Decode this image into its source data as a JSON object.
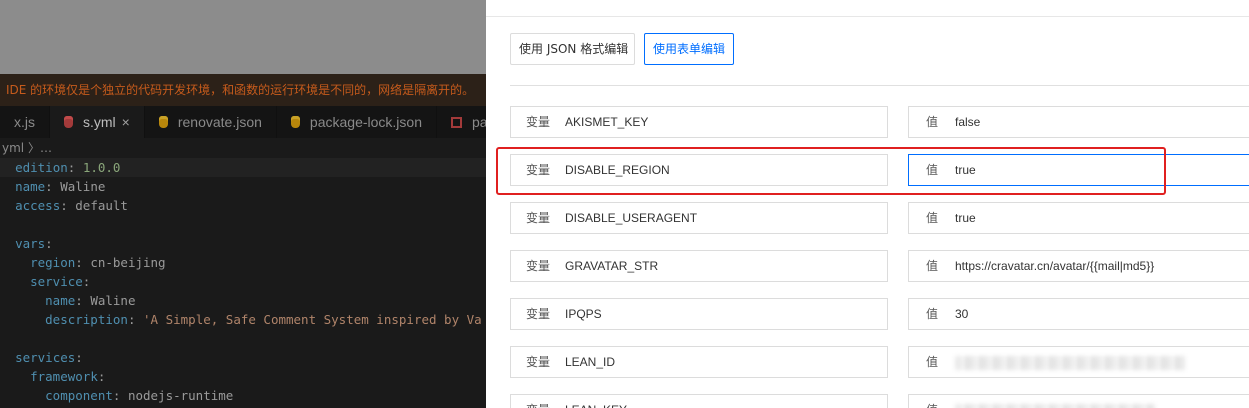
{
  "ide": {
    "notice": "IDE 的环境仅是个独立的代码开发环境，和函数的运行环境是不同的，网络是隔离开的。",
    "tabs": [
      {
        "label": "x.js",
        "icon": "none",
        "active": false
      },
      {
        "label": "s.yml",
        "icon": "database-icon",
        "active": true,
        "close": "×"
      },
      {
        "label": "renovate.json",
        "icon": "database-icon",
        "active": false
      },
      {
        "label": "package-lock.json",
        "icon": "database-icon",
        "active": false
      },
      {
        "label": "package.j",
        "icon": "package-icon",
        "active": false
      }
    ],
    "breadcrumb": "yml 〉…",
    "code": {
      "l1k": "edition",
      "l1v": "1.0.0",
      "l2k": "name",
      "l2v": "Waline",
      "l3k": "access",
      "l3v": "default",
      "l5k": "vars",
      "l6k": "region",
      "l6v": "cn-beijing",
      "l7k": "service",
      "l8k": "name",
      "l8v": "Waline",
      "l9k": "description",
      "l9v": "'A Simple, Safe Comment System inspired by Va",
      "l11k": "services",
      "l12k": "framework",
      "l13k": "component",
      "l13v": "nodejs-runtime"
    }
  },
  "panel": {
    "json_mode_label": "使用 JSON 格式编辑",
    "form_mode_label": "使用表单编辑",
    "key_prefix": "变量",
    "value_prefix": "值",
    "rows": [
      {
        "key": "AKISMET_KEY",
        "value": "false"
      },
      {
        "key": "DISABLE_REGION",
        "value": "true"
      },
      {
        "key": "DISABLE_USERAGENT",
        "value": "true"
      },
      {
        "key": "GRAVATAR_STR",
        "value": "https://cravatar.cn/avatar/{{mail|md5}}"
      },
      {
        "key": "IPQPS",
        "value": "30"
      },
      {
        "key": "LEAN_ID",
        "value": ""
      },
      {
        "key": "LEAN_KEY",
        "value": ""
      }
    ]
  },
  "colors": {
    "accent": "#006eff",
    "highlight": "#e02020",
    "notice_text": "#c65b1c"
  }
}
